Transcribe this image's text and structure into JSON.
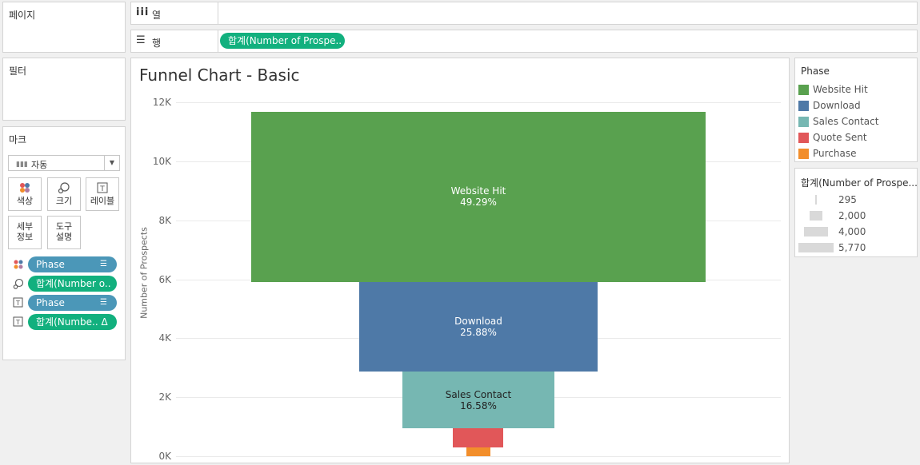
{
  "sidebar": {
    "pages_title": "페이지",
    "filters_title": "필터",
    "marks": {
      "title": "마크",
      "mark_type": "자동",
      "buttons": [
        {
          "label": "색상",
          "icon": "color-palette-icon"
        },
        {
          "label": "크기",
          "icon": "size-icon"
        },
        {
          "label": "레이블",
          "icon": "label-icon"
        },
        {
          "label": "세부\n정보",
          "icon": "detail-icon"
        },
        {
          "label": "도구\n설명",
          "icon": "tooltip-icon"
        }
      ],
      "fields": [
        {
          "icon": "color-dots-icon",
          "pill": "Phase",
          "kind": "blue"
        },
        {
          "icon": "size-icon",
          "pill": "합계(Number o..",
          "kind": "green"
        },
        {
          "icon": "label-icon",
          "pill": "Phase",
          "kind": "blue"
        },
        {
          "icon": "label-icon",
          "pill": "합계(Numbe.. Δ",
          "kind": "green"
        }
      ]
    }
  },
  "shelves": {
    "columns": {
      "label": "열",
      "icon": "columns-icon"
    },
    "rows": {
      "label": "행",
      "icon": "rows-icon",
      "pill": "합계(Number of Prospe.."
    }
  },
  "chart": {
    "title": "Funnel Chart - Basic",
    "ylabel": "Number of Prospects",
    "yticks": [
      "0K",
      "2K",
      "4K",
      "6K",
      "8K",
      "10K",
      "12K"
    ]
  },
  "chart_data": {
    "type": "bar",
    "title": "Funnel Chart - Basic",
    "ylabel": "Number of Prospects",
    "ylim": [
      0,
      12000
    ],
    "categories": [
      "Website Hit",
      "Download",
      "Sales Contact",
      "Quote Sent",
      "Purchase"
    ],
    "values": [
      5770,
      3030,
      1940,
      640,
      295
    ],
    "labels": [
      "Website Hit\n49.29%",
      "Download\n25.88%",
      "Sales Contact\n16.58%",
      "",
      ""
    ],
    "colors": [
      "#59a14f",
      "#4e79a7",
      "#76b7b2",
      "#e15759",
      "#f28e2b"
    ]
  },
  "legend": {
    "color_title": "Phase",
    "items": [
      {
        "label": "Website Hit",
        "color": "#59a14f"
      },
      {
        "label": "Download",
        "color": "#4e79a7"
      },
      {
        "label": "Sales Contact",
        "color": "#76b7b2"
      },
      {
        "label": "Quote Sent",
        "color": "#e15759"
      },
      {
        "label": "Purchase",
        "color": "#f28e2b"
      }
    ],
    "size_title": "합계(Number of Prospe...",
    "sizes": [
      {
        "label": "295",
        "value": 295
      },
      {
        "label": "2,000",
        "value": 2000
      },
      {
        "label": "4,000",
        "value": 4000
      },
      {
        "label": "5,770",
        "value": 5770
      }
    ]
  }
}
